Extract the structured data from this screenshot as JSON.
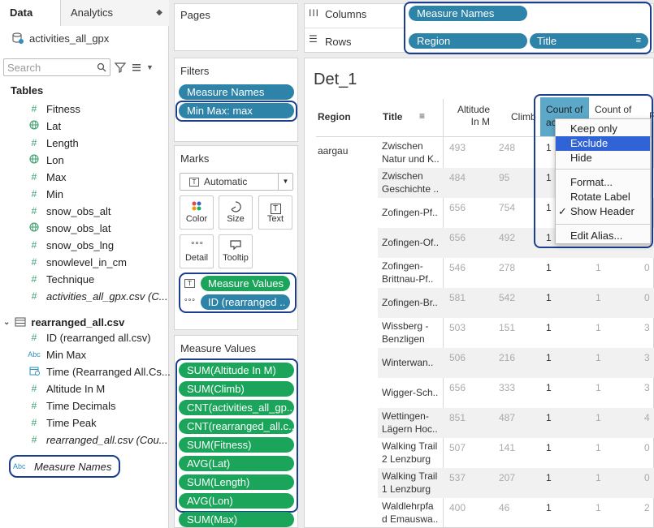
{
  "left": {
    "tabs": {
      "data": "Data",
      "analytics": "Analytics"
    },
    "datasource": "activities_all_gpx",
    "search_placeholder": "Search",
    "tables_heading": "Tables",
    "table1_fields": [
      {
        "icon": "#",
        "label": "Fitness"
      },
      {
        "icon": "globe",
        "label": "Lat"
      },
      {
        "icon": "#",
        "label": "Length"
      },
      {
        "icon": "globe",
        "label": "Lon"
      },
      {
        "icon": "#",
        "label": "Max"
      },
      {
        "icon": "#",
        "label": "Min"
      },
      {
        "icon": "#",
        "label": "snow_obs_alt"
      },
      {
        "icon": "globe",
        "label": "snow_obs_lat"
      },
      {
        "icon": "#",
        "label": "snow_obs_lng"
      },
      {
        "icon": "#",
        "label": "snowlevel_in_cm"
      },
      {
        "icon": "#",
        "label": "Technique"
      },
      {
        "icon": "#",
        "label": "activities_all_gpx.csv (C..."
      }
    ],
    "table2_name": "rearranged_all.csv",
    "table2_fields": [
      {
        "icon": "#",
        "label": "ID (rearranged all.csv)"
      },
      {
        "icon": "Abc",
        "label": "Min Max"
      },
      {
        "icon": "cal",
        "label": "Time (Rearranged All.Cs..."
      },
      {
        "icon": "#",
        "label": "Altitude In M"
      },
      {
        "icon": "#",
        "label": "Time Decimals"
      },
      {
        "icon": "#",
        "label": "Time Peak"
      },
      {
        "icon": "#",
        "label": "rearranged_all.csv (Cou..."
      }
    ],
    "measure_names_icon": "Abc",
    "measure_names": "Measure Names"
  },
  "pages": {
    "title": "Pages"
  },
  "filters": {
    "title": "Filters",
    "items": [
      "Measure Names",
      "Min Max: max"
    ]
  },
  "marks": {
    "title": "Marks",
    "type": "Automatic",
    "buttons": [
      "Color",
      "Size",
      "Text",
      "Detail",
      "Tooltip"
    ],
    "pills": [
      "Measure Values",
      "ID (rearranged .."
    ]
  },
  "measure_values": {
    "title": "Measure Values",
    "items": [
      "SUM(Altitude In M)",
      "SUM(Climb)",
      "CNT(activities_all_gp..",
      "CNT(rearranged_all.c..",
      "SUM(Fitness)",
      "AVG(Lat)",
      "SUM(Length)",
      "AVG(Lon)",
      "SUM(Max)"
    ]
  },
  "shelves": {
    "columns_label": "Columns",
    "columns_pill": "Measure Names",
    "rows_label": "Rows",
    "rows_pills": [
      "Region",
      "Title"
    ]
  },
  "view": {
    "sheet_title": "Det_1",
    "headers": {
      "region": "Region",
      "title": "Title",
      "altitude": "Altitude In M",
      "climb": "Climb",
      "count1_a": "Count of",
      "count1_b": "ac",
      "count2": "Count of",
      "edge": "F"
    },
    "region_value": "aargau",
    "rows": [
      {
        "title": [
          "Zwischen",
          "Natur und K.."
        ],
        "alt": "493",
        "climb": "248",
        "c1": "1",
        "c2": "",
        "c3": ""
      },
      {
        "title": [
          "Zwischen",
          "Geschichte .."
        ],
        "alt": "484",
        "climb": "95",
        "c1": "1",
        "c2": "",
        "c3": ""
      },
      {
        "title": [
          "Zofingen-Pf.."
        ],
        "alt": "656",
        "climb": "754",
        "c1": "1",
        "c2": "",
        "c3": ""
      },
      {
        "title": [
          "Zofingen-Of.."
        ],
        "alt": "656",
        "climb": "492",
        "c1": "1",
        "c2": "",
        "c3": ""
      },
      {
        "title": [
          "Zofingen-",
          "Brittnau-Pf.."
        ],
        "alt": "546",
        "climb": "278",
        "c1": "1",
        "c2": "1",
        "c3": "0"
      },
      {
        "title": [
          "Zofingen-Br.."
        ],
        "alt": "581",
        "climb": "542",
        "c1": "1",
        "c2": "1",
        "c3": "0"
      },
      {
        "title": [
          "Wissberg -",
          "Benzligen"
        ],
        "alt": "503",
        "climb": "151",
        "c1": "1",
        "c2": "1",
        "c3": "3"
      },
      {
        "title": [
          "Winterwan.."
        ],
        "alt": "506",
        "climb": "216",
        "c1": "1",
        "c2": "1",
        "c3": "3"
      },
      {
        "title": [
          "Wigger-Sch.."
        ],
        "alt": "656",
        "climb": "333",
        "c1": "1",
        "c2": "1",
        "c3": "3"
      },
      {
        "title": [
          "Wettingen-",
          "Lägern Hoc.."
        ],
        "alt": "851",
        "climb": "487",
        "c1": "1",
        "c2": "1",
        "c3": "4"
      },
      {
        "title": [
          "Walking Trail",
          "2 Lenzburg"
        ],
        "alt": "507",
        "climb": "141",
        "c1": "1",
        "c2": "1",
        "c3": "0"
      },
      {
        "title": [
          "Walking Trail",
          "1 Lenzburg"
        ],
        "alt": "537",
        "climb": "207",
        "c1": "1",
        "c2": "1",
        "c3": "0"
      },
      {
        "title": [
          "Waldlehrpfa",
          "d Emauswa.."
        ],
        "alt": "400",
        "climb": "46",
        "c1": "1",
        "c2": "1",
        "c3": "2"
      }
    ]
  },
  "context_menu": {
    "items": [
      "Keep only",
      "Exclude",
      "Hide",
      "Format...",
      "Rotate Label",
      "Show Header",
      "Edit Alias..."
    ],
    "checked_mark": "✓",
    "selected": "Exclude"
  },
  "colors": {
    "blue_pill": "#2d83a8",
    "green_pill": "#1ba55b",
    "highlight": "#1c3e8f",
    "menu_selection": "#2f63d6"
  }
}
